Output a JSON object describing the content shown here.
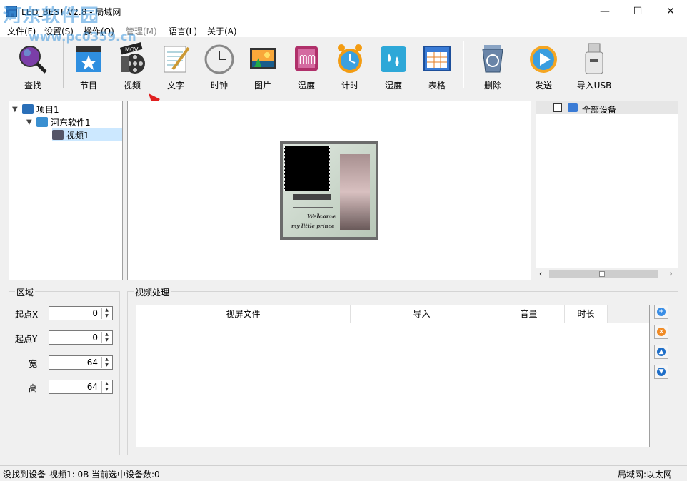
{
  "window": {
    "title": "LED_BEST V2.8 - 局域网",
    "watermark": "河东软件园",
    "watermark_url": "www.pc0359.cn",
    "minimize": "—",
    "maximize": "☐",
    "close": "✕"
  },
  "menu": [
    "文件(F)",
    "设置(S)",
    "操作(O)",
    "管理(M)",
    "语言(L)",
    "关于(A)"
  ],
  "toolbar": {
    "search": "查找",
    "program": "节目",
    "video": "视频",
    "text": "文字",
    "clock": "时钟",
    "picture": "图片",
    "temperature": "温度",
    "timer": "计时",
    "humidity": "湿度",
    "table": "表格",
    "delete": "删除",
    "send": "发送",
    "import_usb": "导入USB"
  },
  "tree": {
    "project": "项目1",
    "program": "河东软件1",
    "video": "视频1"
  },
  "preview": {
    "welcome": "Welcome",
    "subtitle": "my little prince"
  },
  "devices": {
    "all": "全部设备"
  },
  "region": {
    "title": "区域",
    "x_label": "起点X",
    "x_value": "0",
    "y_label": "起点Y",
    "y_value": "0",
    "w_label": "宽",
    "w_value": "64",
    "h_label": "高",
    "h_value": "64"
  },
  "video_processing": {
    "title": "视频处理",
    "columns": [
      "视屏文件",
      "导入",
      "音量",
      "时长"
    ]
  },
  "status": {
    "left": "没找到设备",
    "video": "视频1: 0B",
    "selected": "当前选中设备数:0",
    "network": "局域网:以太网"
  },
  "colors": {
    "accent": "#2a6fb8",
    "selection": "#cce8ff",
    "arrow": "#e02020"
  }
}
